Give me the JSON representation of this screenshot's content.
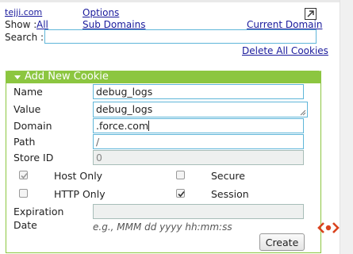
{
  "header": {
    "site_link": "tejji.com",
    "options_link": "Options",
    "popout_icon": "popout-arrow-icon",
    "show_label": "Show :",
    "show_all_link": "All",
    "subdomains_link": "Sub Domains",
    "current_domain_link": "Current Domain",
    "search_label": "Search :",
    "search_value": "",
    "delete_all_link": "Delete All Cookies"
  },
  "panel": {
    "title": "Add New Cookie",
    "fields": {
      "name_label": "Name",
      "name_value": "debug_logs",
      "value_label": "Value",
      "value_value": "debug_logs",
      "domain_label": "Domain",
      "domain_value": ".force.com",
      "path_label": "Path",
      "path_value": "/",
      "store_id_label": "Store ID",
      "store_id_value": "0"
    },
    "options": {
      "host_only_label": "Host Only",
      "host_only_checked": true,
      "secure_label": "Secure",
      "secure_checked": false,
      "http_only_label": "HTTP Only",
      "http_only_checked": false,
      "session_label": "Session",
      "session_checked": true
    },
    "expiration": {
      "label_line1": "Expiration",
      "label_line2": "Date",
      "value": "",
      "format_hint": "e.g., MMM dd yyyy hh:mm:ss"
    },
    "create_button": "Create"
  },
  "colors": {
    "panel_accent": "#8cc640",
    "link": "#1a1a9c",
    "input_border": "#5fb6d9",
    "logo": "#d9431e"
  }
}
